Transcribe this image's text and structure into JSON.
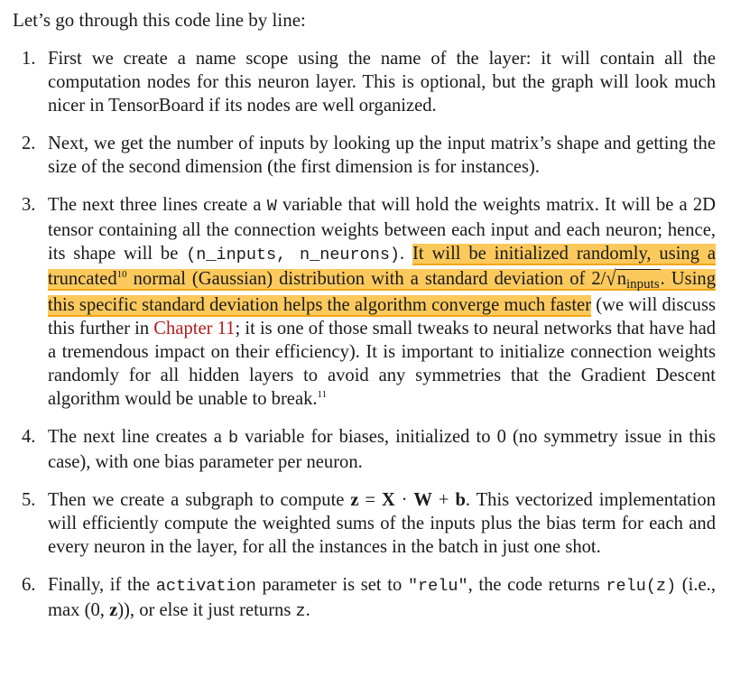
{
  "intro": "Let’s go through this code line by line:",
  "steps": [
    {
      "num": "1.",
      "text": "First we create a name scope using the name of the layer: it will contain all the computation nodes for this neuron layer. This is optional, but the graph will look much nicer in TensorBoard if its nodes are well organized."
    },
    {
      "num": "2.",
      "text": "Next, we get the number of inputs by looking up the input matrix’s shape and getting the size of the second dimension (the first dimension is for instances)."
    },
    {
      "num": "3.",
      "a": "The next three lines create a ",
      "code_w": "W",
      "b": " variable that will hold the weights matrix. It will be a 2D tensor containing all the connection weights between each input and each neuron; hence, its shape will be ",
      "code_shape": "(n_inputs, n_neurons)",
      "c": ". ",
      "hl1": "It will be initialized randomly, using a truncated",
      "fn10": "10",
      "hl2": " normal (Gaussian) distribution with a standard deviation of 2/",
      "sqrt_radical": "√",
      "sqrt_n": "n",
      "sqrt_sub": "inputs",
      "hl3": ". Using this specific standard deviation helps the algorithm converge much faster",
      "d": " (we will discuss this further in ",
      "link": "Chapter 11",
      "e": "; it is one of those small tweaks to neural networks that have had a tremendous impact on their efficiency). It is important to initialize connection weights randomly for all hidden layers to avoid any symmetries that the Gradient Descent algorithm would be unable to break.",
      "fn11": "11"
    },
    {
      "num": "4.",
      "a": "The next line creates a ",
      "code_b": "b",
      "b": " variable for biases, initialized to 0 (no symmetry issue in this case), with one bias parameter per neuron."
    },
    {
      "num": "5.",
      "a": "Then we create a subgraph to compute ",
      "m_z": "z",
      "m_eq": " = ",
      "m_x": "X",
      "m_dot": " · ",
      "m_w": "W",
      "m_plus": " + ",
      "m_b": "b",
      "b": ". This vectorized implementation will efficiently compute the weighted sums of the inputs plus the bias term for each and every neuron in the layer, for all the instances in the batch in just one shot."
    },
    {
      "num": "6.",
      "a": "Finally, if the ",
      "code_act": "activation",
      "b": " parameter is set to ",
      "code_relu_str": "\"relu\"",
      "c": ", the code returns ",
      "code_reluz": "relu(z)",
      "d": " (i.e., max (0, ",
      "m_z": "z",
      "e": ")), or else it just returns ",
      "code_z": "z",
      "f": "."
    }
  ]
}
